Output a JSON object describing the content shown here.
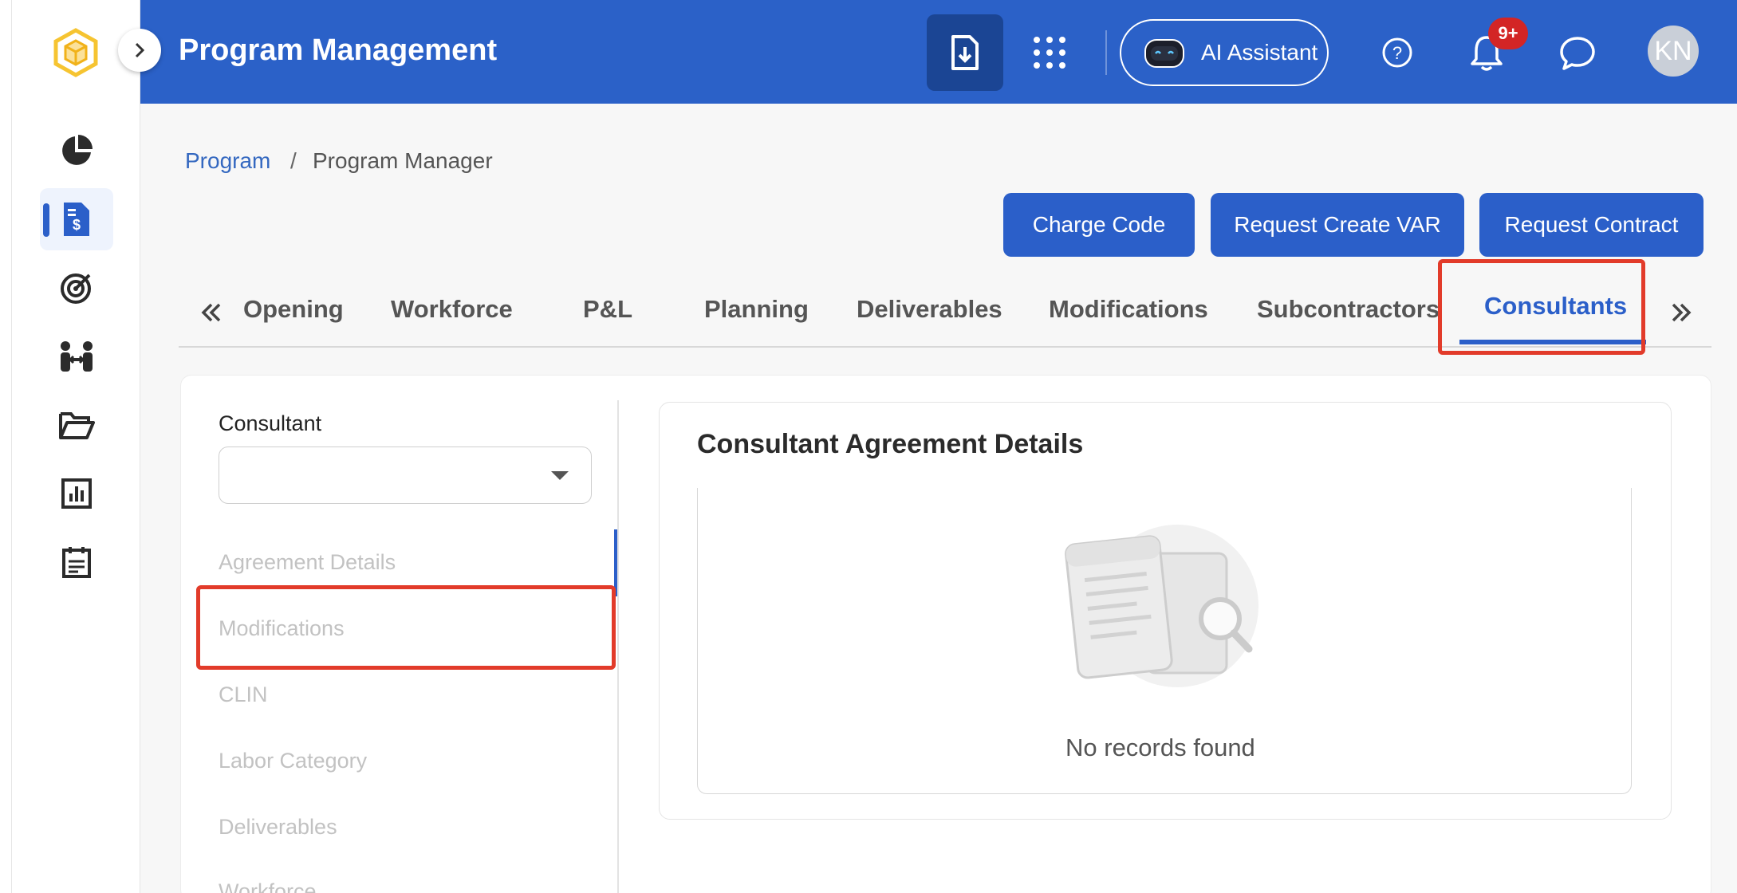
{
  "header": {
    "title": "Program Management",
    "ai_label": "AI Assistant",
    "notification_count": "9+",
    "avatar_initials": "KN"
  },
  "colors": {
    "primary": "#2b61c8",
    "accent": "#2b5fc9",
    "highlight": "#e23b2a",
    "badge": "#d32525"
  },
  "sidebar": {
    "icons": [
      "logo-icon",
      "pie-chart-icon",
      "invoice-icon",
      "target-icon",
      "team-icon",
      "folder-icon",
      "bar-chart-icon",
      "calendar-icon"
    ]
  },
  "breadcrumb": {
    "root": "Program",
    "separator": "/",
    "current": "Program Manager"
  },
  "actions": {
    "charge_code": "Charge Code",
    "request_var": "Request Create VAR",
    "request_contract": "Request Contract"
  },
  "tabs": [
    "Opening",
    "Workforce",
    "P&L",
    "Planning",
    "Deliverables",
    "Modifications",
    "Subcontractors",
    "Consultants"
  ],
  "active_tab": "Consultants",
  "consultant": {
    "label": "Consultant",
    "selected_value": "",
    "sections": [
      "Agreement Details",
      "Modifications",
      "CLIN",
      "Labor Category",
      "Deliverables",
      "Workforce"
    ]
  },
  "panel": {
    "title": "Consultant Agreement Details",
    "empty_message": "No records found"
  }
}
